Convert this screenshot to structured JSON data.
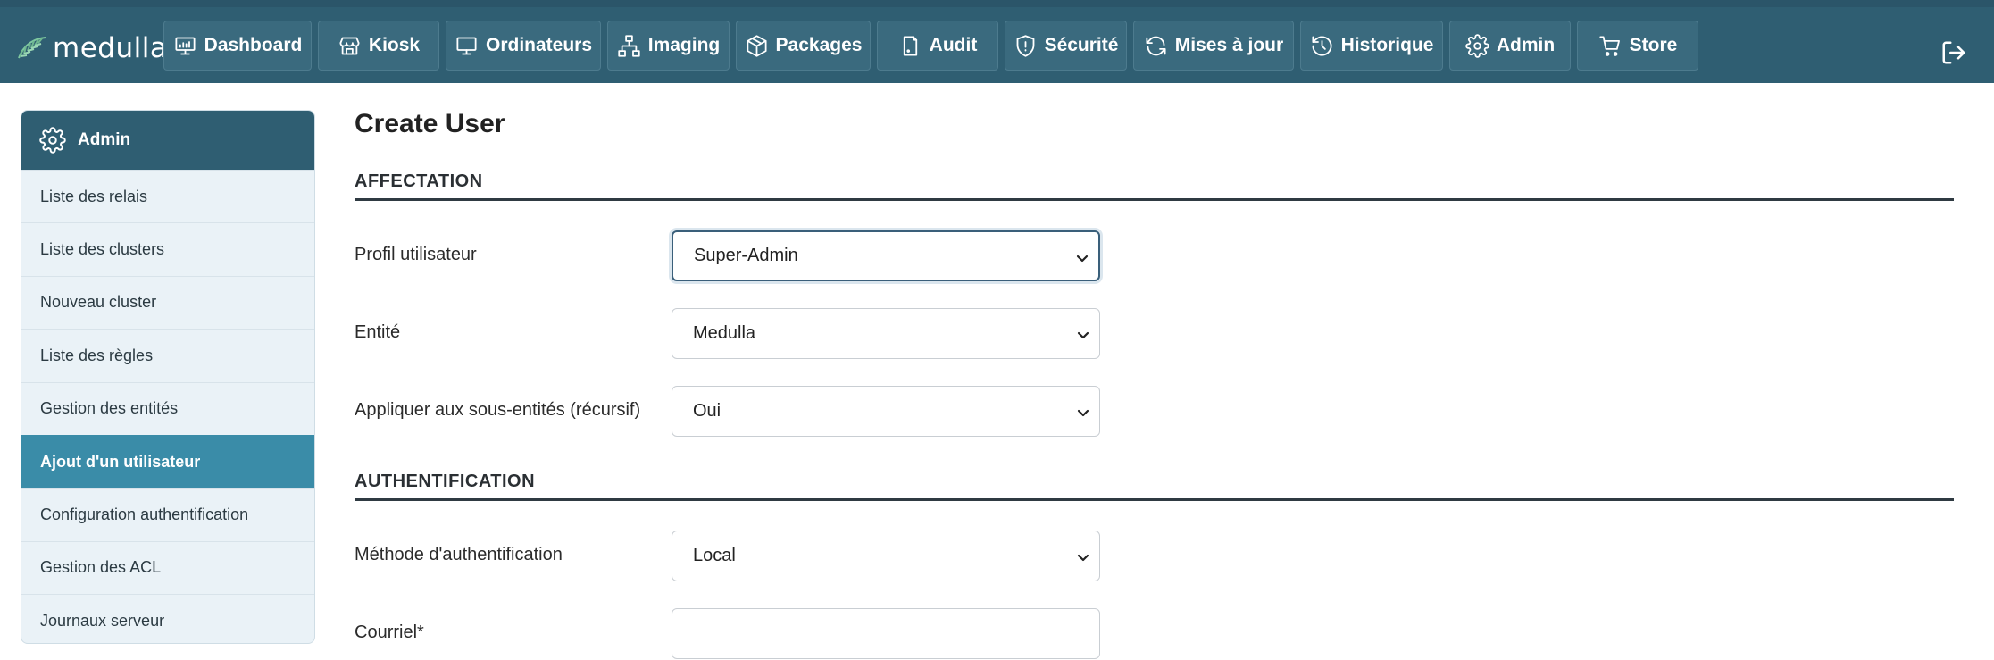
{
  "brand": {
    "name": "medulla"
  },
  "nav": [
    {
      "label": "Dashboard",
      "icon": "dashboard-icon"
    },
    {
      "label": "Kiosk",
      "icon": "kiosk-icon"
    },
    {
      "label": "Ordinateurs",
      "icon": "monitor-icon"
    },
    {
      "label": "Imaging",
      "icon": "network-icon"
    },
    {
      "label": "Packages",
      "icon": "package-icon"
    },
    {
      "label": "Audit",
      "icon": "audit-icon"
    },
    {
      "label": "Sécurité",
      "icon": "shield-icon"
    },
    {
      "label": "Mises à jour",
      "icon": "refresh-icon"
    },
    {
      "label": "Historique",
      "icon": "history-icon"
    },
    {
      "label": "Admin",
      "icon": "gear-icon"
    },
    {
      "label": "Store",
      "icon": "cart-icon"
    }
  ],
  "sidebar": {
    "title": "Admin",
    "items": [
      {
        "label": "Liste des relais"
      },
      {
        "label": "Liste des clusters"
      },
      {
        "label": "Nouveau cluster"
      },
      {
        "label": "Liste des règles"
      },
      {
        "label": "Gestion des entités"
      },
      {
        "label": "Ajout d'un utilisateur",
        "active": true
      },
      {
        "label": "Configuration authentification"
      },
      {
        "label": "Gestion des ACL"
      },
      {
        "label": "Journaux serveur"
      }
    ]
  },
  "main": {
    "title": "Create User",
    "sections": {
      "affectation": "AFFECTATION",
      "authentification": "AUTHENTIFICATION"
    },
    "fields": {
      "profile": {
        "label": "Profil utilisateur",
        "value": "Super-Admin"
      },
      "entity": {
        "label": "Entité",
        "value": "Medulla"
      },
      "recursive": {
        "label": "Appliquer aux sous-entités (récursif)",
        "value": "Oui"
      },
      "auth_method": {
        "label": "Méthode d'authentification",
        "value": "Local"
      },
      "email": {
        "label": "Courriel*",
        "value": ""
      }
    }
  },
  "colors": {
    "topbar": "#2f5e72",
    "nav_button": "#3a6a7e",
    "sidebar_active": "#3a8ca8",
    "sidebar_bg": "#eaf2f7"
  }
}
